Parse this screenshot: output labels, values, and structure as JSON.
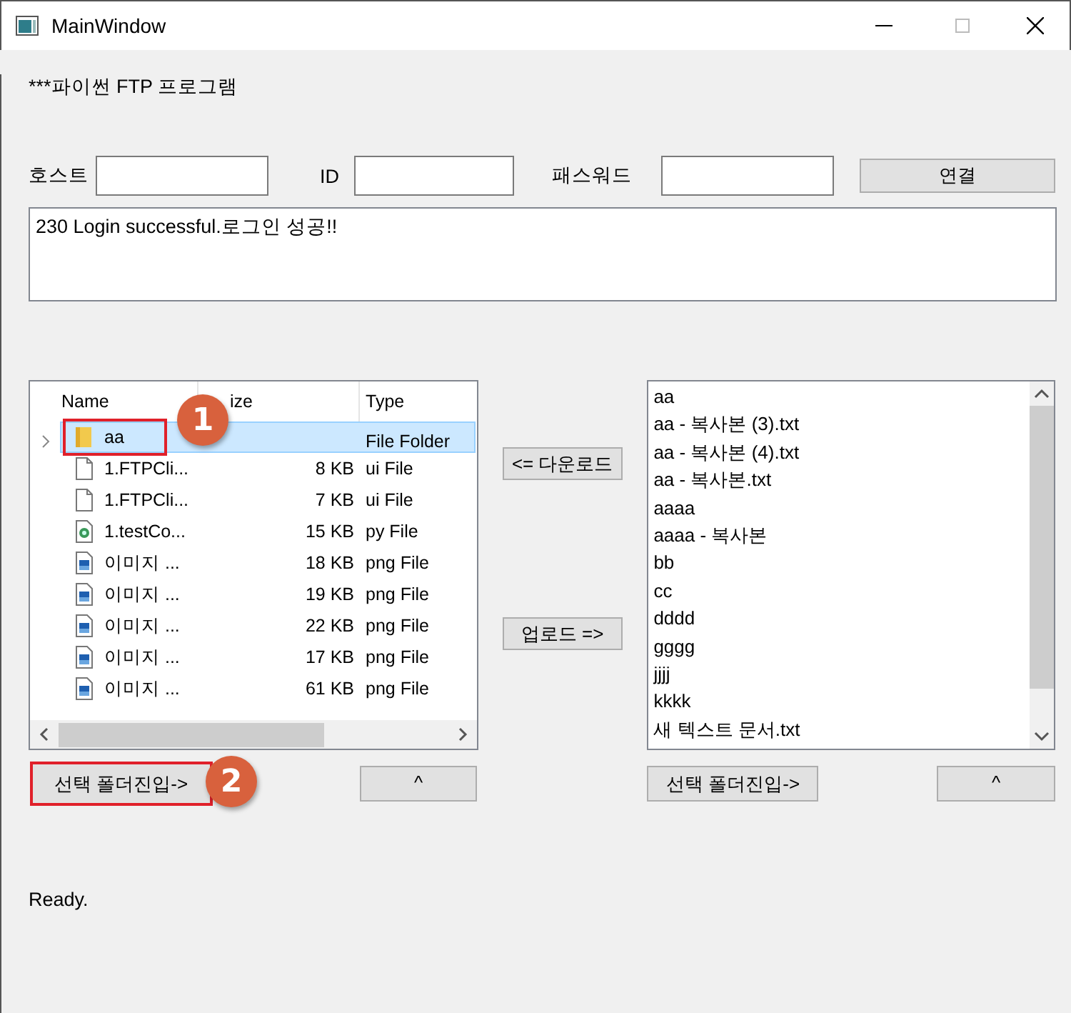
{
  "window": {
    "title": "MainWindow"
  },
  "heading": "***파이썬 FTP 프로그램",
  "login": {
    "fields": [
      {
        "label": "호스트"
      },
      {
        "label": "ID"
      },
      {
        "label": "패스워드"
      }
    ],
    "connect_button": "연결"
  },
  "log": "230 Login successful.로그인 성공!!",
  "local_files": {
    "columns": [
      "Name",
      "ize",
      "Type"
    ],
    "rows": [
      {
        "name": "aa",
        "size": "",
        "type": "File Folder",
        "kind": "folder",
        "selected": true,
        "expandable": true,
        "highlighted": true,
        "badge": "1"
      },
      {
        "name": "1.FTPCli...",
        "size": "8 KB",
        "type": "ui File",
        "kind": "file",
        "selected": false,
        "expandable": false,
        "highlighted": false
      },
      {
        "name": "1.FTPCli...",
        "size": "7 KB",
        "type": "ui File",
        "kind": "file",
        "selected": false,
        "expandable": false,
        "highlighted": false
      },
      {
        "name": "1.testCo...",
        "size": "15 KB",
        "type": "py File",
        "kind": "python",
        "selected": false,
        "expandable": false,
        "highlighted": false
      },
      {
        "name": "이미지 ...",
        "size": "18 KB",
        "type": "png File",
        "kind": "image",
        "selected": false,
        "expandable": false,
        "highlighted": false
      },
      {
        "name": "이미지 ...",
        "size": "19 KB",
        "type": "png File",
        "kind": "image",
        "selected": false,
        "expandable": false,
        "highlighted": false
      },
      {
        "name": "이미지 ...",
        "size": "22 KB",
        "type": "png File",
        "kind": "image",
        "selected": false,
        "expandable": false,
        "highlighted": false
      },
      {
        "name": "이미지 ...",
        "size": "17 KB",
        "type": "png File",
        "kind": "image",
        "selected": false,
        "expandable": false,
        "highlighted": false
      },
      {
        "name": "이미지 ...",
        "size": "61 KB",
        "type": "png File",
        "kind": "image",
        "selected": false,
        "expandable": false,
        "highlighted": false
      }
    ],
    "enter_button": {
      "label": "선택 폴더진입->",
      "highlighted": true,
      "badge": "2"
    },
    "up_button": "^"
  },
  "transfer_buttons": [
    "<= 다운로드",
    "업로드 =>"
  ],
  "remote_files": {
    "items": [
      "aa",
      "aa - 복사본 (3).txt",
      "aa - 복사본 (4).txt",
      "aa - 복사본.txt",
      "aaaa",
      "aaaa - 복사본",
      "bb",
      "cc",
      "dddd",
      "gggg",
      "jjjj",
      "kkkk",
      "새 텍스트 문서.txt"
    ],
    "enter_button": {
      "label": "선택 폴더진입->",
      "highlighted": false
    },
    "up_button": "^"
  },
  "status_bar": "Ready."
}
